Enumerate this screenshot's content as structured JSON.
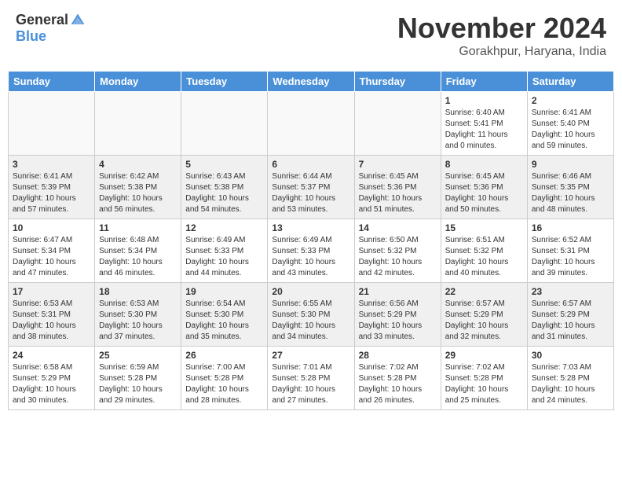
{
  "header": {
    "logo_general": "General",
    "logo_blue": "Blue",
    "month_title": "November 2024",
    "location": "Gorakhpur, Haryana, India"
  },
  "weekdays": [
    "Sunday",
    "Monday",
    "Tuesday",
    "Wednesday",
    "Thursday",
    "Friday",
    "Saturday"
  ],
  "weeks": [
    [
      {
        "day": "",
        "info": ""
      },
      {
        "day": "",
        "info": ""
      },
      {
        "day": "",
        "info": ""
      },
      {
        "day": "",
        "info": ""
      },
      {
        "day": "",
        "info": ""
      },
      {
        "day": "1",
        "info": "Sunrise: 6:40 AM\nSunset: 5:41 PM\nDaylight: 11 hours\nand 0 minutes."
      },
      {
        "day": "2",
        "info": "Sunrise: 6:41 AM\nSunset: 5:40 PM\nDaylight: 10 hours\nand 59 minutes."
      }
    ],
    [
      {
        "day": "3",
        "info": "Sunrise: 6:41 AM\nSunset: 5:39 PM\nDaylight: 10 hours\nand 57 minutes."
      },
      {
        "day": "4",
        "info": "Sunrise: 6:42 AM\nSunset: 5:38 PM\nDaylight: 10 hours\nand 56 minutes."
      },
      {
        "day": "5",
        "info": "Sunrise: 6:43 AM\nSunset: 5:38 PM\nDaylight: 10 hours\nand 54 minutes."
      },
      {
        "day": "6",
        "info": "Sunrise: 6:44 AM\nSunset: 5:37 PM\nDaylight: 10 hours\nand 53 minutes."
      },
      {
        "day": "7",
        "info": "Sunrise: 6:45 AM\nSunset: 5:36 PM\nDaylight: 10 hours\nand 51 minutes."
      },
      {
        "day": "8",
        "info": "Sunrise: 6:45 AM\nSunset: 5:36 PM\nDaylight: 10 hours\nand 50 minutes."
      },
      {
        "day": "9",
        "info": "Sunrise: 6:46 AM\nSunset: 5:35 PM\nDaylight: 10 hours\nand 48 minutes."
      }
    ],
    [
      {
        "day": "10",
        "info": "Sunrise: 6:47 AM\nSunset: 5:34 PM\nDaylight: 10 hours\nand 47 minutes."
      },
      {
        "day": "11",
        "info": "Sunrise: 6:48 AM\nSunset: 5:34 PM\nDaylight: 10 hours\nand 46 minutes."
      },
      {
        "day": "12",
        "info": "Sunrise: 6:49 AM\nSunset: 5:33 PM\nDaylight: 10 hours\nand 44 minutes."
      },
      {
        "day": "13",
        "info": "Sunrise: 6:49 AM\nSunset: 5:33 PM\nDaylight: 10 hours\nand 43 minutes."
      },
      {
        "day": "14",
        "info": "Sunrise: 6:50 AM\nSunset: 5:32 PM\nDaylight: 10 hours\nand 42 minutes."
      },
      {
        "day": "15",
        "info": "Sunrise: 6:51 AM\nSunset: 5:32 PM\nDaylight: 10 hours\nand 40 minutes."
      },
      {
        "day": "16",
        "info": "Sunrise: 6:52 AM\nSunset: 5:31 PM\nDaylight: 10 hours\nand 39 minutes."
      }
    ],
    [
      {
        "day": "17",
        "info": "Sunrise: 6:53 AM\nSunset: 5:31 PM\nDaylight: 10 hours\nand 38 minutes."
      },
      {
        "day": "18",
        "info": "Sunrise: 6:53 AM\nSunset: 5:30 PM\nDaylight: 10 hours\nand 37 minutes."
      },
      {
        "day": "19",
        "info": "Sunrise: 6:54 AM\nSunset: 5:30 PM\nDaylight: 10 hours\nand 35 minutes."
      },
      {
        "day": "20",
        "info": "Sunrise: 6:55 AM\nSunset: 5:30 PM\nDaylight: 10 hours\nand 34 minutes."
      },
      {
        "day": "21",
        "info": "Sunrise: 6:56 AM\nSunset: 5:29 PM\nDaylight: 10 hours\nand 33 minutes."
      },
      {
        "day": "22",
        "info": "Sunrise: 6:57 AM\nSunset: 5:29 PM\nDaylight: 10 hours\nand 32 minutes."
      },
      {
        "day": "23",
        "info": "Sunrise: 6:57 AM\nSunset: 5:29 PM\nDaylight: 10 hours\nand 31 minutes."
      }
    ],
    [
      {
        "day": "24",
        "info": "Sunrise: 6:58 AM\nSunset: 5:29 PM\nDaylight: 10 hours\nand 30 minutes."
      },
      {
        "day": "25",
        "info": "Sunrise: 6:59 AM\nSunset: 5:28 PM\nDaylight: 10 hours\nand 29 minutes."
      },
      {
        "day": "26",
        "info": "Sunrise: 7:00 AM\nSunset: 5:28 PM\nDaylight: 10 hours\nand 28 minutes."
      },
      {
        "day": "27",
        "info": "Sunrise: 7:01 AM\nSunset: 5:28 PM\nDaylight: 10 hours\nand 27 minutes."
      },
      {
        "day": "28",
        "info": "Sunrise: 7:02 AM\nSunset: 5:28 PM\nDaylight: 10 hours\nand 26 minutes."
      },
      {
        "day": "29",
        "info": "Sunrise: 7:02 AM\nSunset: 5:28 PM\nDaylight: 10 hours\nand 25 minutes."
      },
      {
        "day": "30",
        "info": "Sunrise: 7:03 AM\nSunset: 5:28 PM\nDaylight: 10 hours\nand 24 minutes."
      }
    ]
  ]
}
